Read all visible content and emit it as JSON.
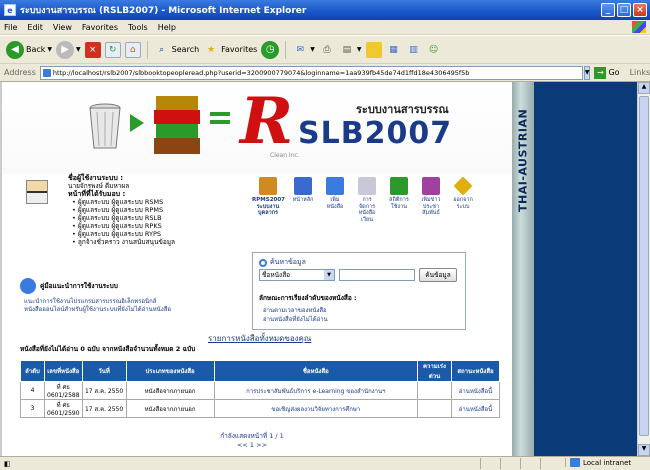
{
  "window": {
    "title": "ระบบงานสารบรรณ (RSLB2007) - Microsoft Internet Explorer"
  },
  "menu": [
    "File",
    "Edit",
    "View",
    "Favorites",
    "Tools",
    "Help"
  ],
  "toolbar": {
    "back": "Back",
    "search": "Search",
    "favorites": "Favorites"
  },
  "address": {
    "label": "Address",
    "url": "http://localhost/rslb2007/slbbooktopeopleread.php?userid=3200900779074&loginname=1aa939fb45de74d1ffd18e4306495f5b",
    "go": "Go",
    "links": "Links"
  },
  "status": {
    "zone": "Local intranet"
  },
  "sidebar": {
    "text": "THAI-AUSTRIAN"
  },
  "banner": {
    "thai_title": "ระบบงานสารบรรณ",
    "logo_r": "R",
    "logo_text": "SLB2007",
    "tagline": "Clean Inc."
  },
  "user": {
    "name_label": "ชื่อผู้ใช้งานระบบ :",
    "name": "นายจักรพงษ์ ดีมหาผล",
    "roles_label": "หน้าที่ที่ได้รับมอบ :",
    "roles": [
      "ผู้ดูแลระบบ ผู้ดูแลระบบ RSMS",
      "ผู้ดูแลระบบ ผู้ดูแลระบบ RPMS",
      "ผู้ดูแลระบบ ผู้ดูแลระบบ RSLB",
      "ผู้ดูแลระบบ ผู้ดูแลระบบ RPKS",
      "ผู้ดูแลระบบ ผู้ดูแลระบบ RYPS",
      "ลูกจ้างชั่วคราว งานสนับสนุนข้อมูล"
    ]
  },
  "icons": [
    {
      "label": "RPMS2007 ระบบงานบุคลากร",
      "color": "#d08a20"
    },
    {
      "label": "หน้าหลัก",
      "color": "#3a6ad0"
    },
    {
      "label": "เพิ่ม หนังสือ",
      "color": "#3a7be0"
    },
    {
      "label": "การ จัดการ หนังสือ เวียน",
      "color": "#c8c8d8"
    },
    {
      "label": "สถิติการ ใช้งาน",
      "color": "#2a9a2a"
    },
    {
      "label": "เพิ่มข่าว ประชา สัมพันธ์",
      "color": "#a040a0"
    },
    {
      "label": "ออกจาก ระบบ",
      "color": "#e0b010"
    }
  ],
  "search": {
    "heading": "ค้นหาข้อมูล",
    "select_value": "ชื่อหนังสือ",
    "button": "ค้นข้อมูล",
    "sub_heading": "ลักษณะการเรียงลำดับของหนังสือ :",
    "links": [
      "อ่านตามเวลาของหนังสือ",
      "อ่านหนังสือที่ยังไม่ได้อ่าน"
    ]
  },
  "manual": {
    "heading": "คู่มือแนะนำการใช้งานระบบ",
    "links": [
      "แนะนำการใช้งานโปรแกรมสารบรรณอิเล็กทรอนิกส์",
      "หนังสือออนไลน์สำหรับผู้ใช้งานระบบที่ยังไม่ได้อ่านหนังสือ"
    ]
  },
  "list": {
    "title": "รายการหนังสือทั้งหมดของคุณ",
    "result_info": "หนังสือที่ยังไม่ได้อ่าน 0 ฉบับ จากหนังสือจำนวนทั้งหมด 2 ฉบับ",
    "headers": [
      "ลำดับ",
      "เลขที่หนังสือ",
      "วันที่",
      "ประเภทของหนังสือ",
      "ชื่อหนังสือ",
      "ความเร่งด่วน",
      "สถานะหนังสือ"
    ],
    "rows": [
      [
        "4",
        "ที่ ศธ 0601/2588",
        "17 ส.ค. 2550",
        "หนังสือจากภายนอก",
        "การประชาสัมพันธ์บริการ e-Learning ของสำนักงานฯ",
        "",
        "อ่านหนังสือนี้"
      ],
      [
        "3",
        "ที่ ศธ 0601/2590",
        "17 ส.ค. 2550",
        "หนังสือจากภายนอก",
        "ขอเชิญส่งผลงานวิจัยทางการศึกษา",
        "",
        "อ่านหนังสือนี้"
      ]
    ]
  },
  "pager": {
    "summary": "กำลังแสดงหน้าที่ 1 / 1",
    "nav": "<< 1 >>"
  }
}
